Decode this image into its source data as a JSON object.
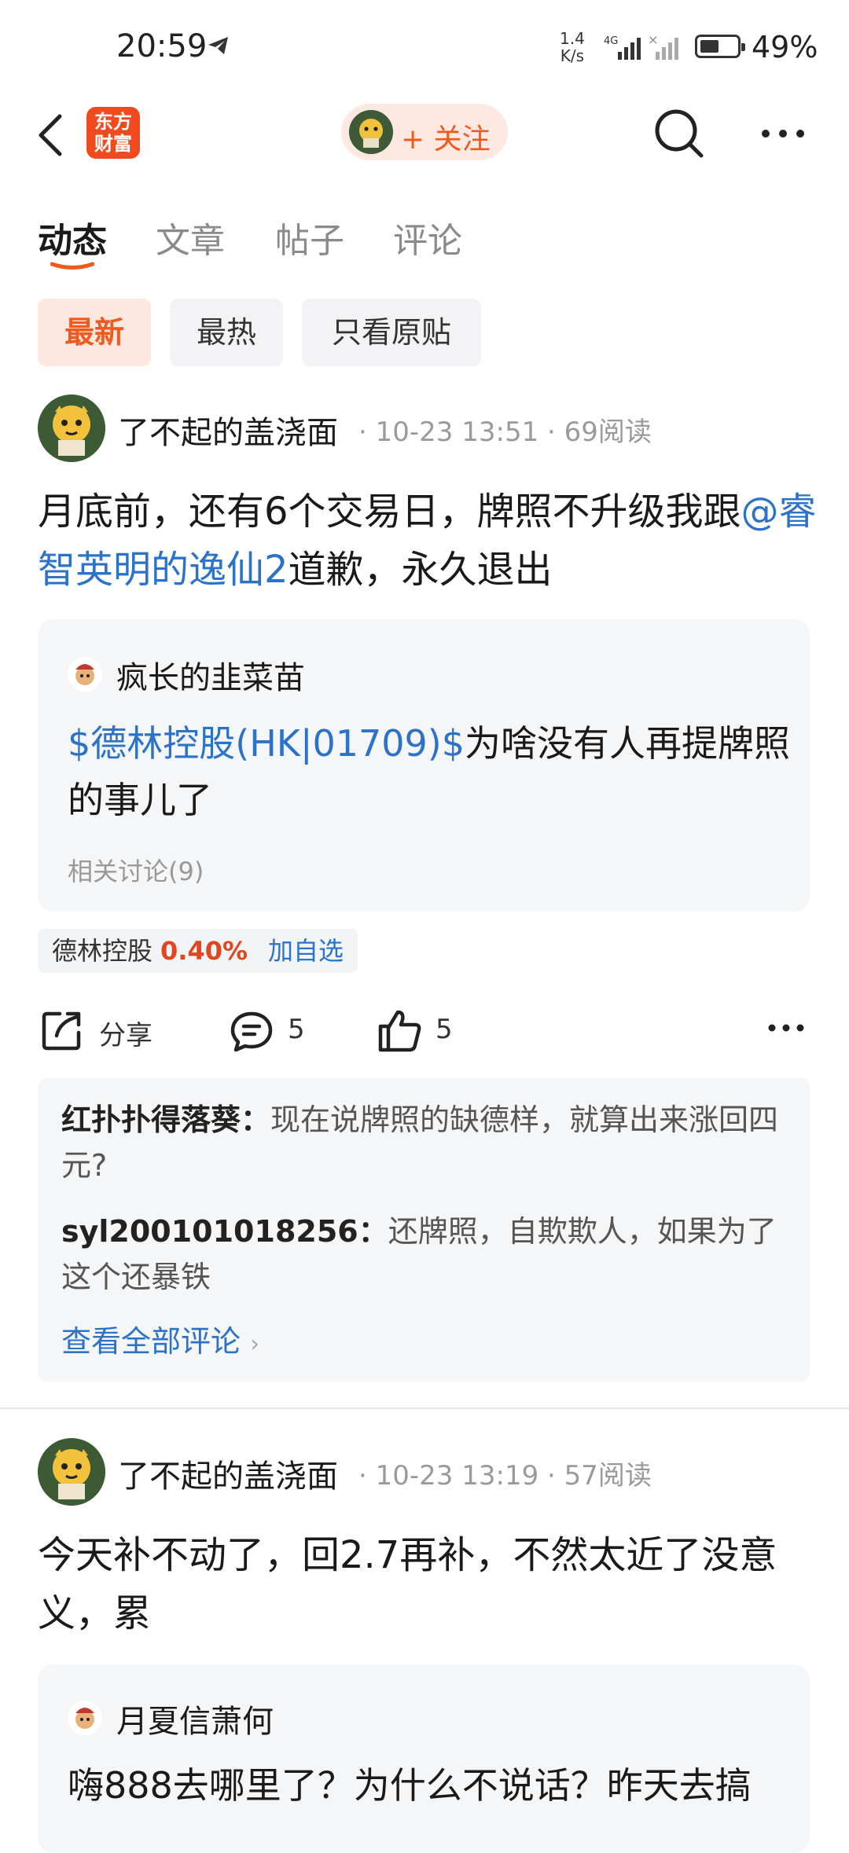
{
  "status_bar": {
    "time": "20:59",
    "net_speed_value": "1.4",
    "net_speed_unit": "K/s",
    "network_type": "4G",
    "battery_percent": "49%",
    "battery_level": 0.49
  },
  "header": {
    "logo_line1": "东方",
    "logo_line2": "财富",
    "follow_label": "+ 关注",
    "accent": "#f05a1e"
  },
  "tabs": [
    "动态",
    "文章",
    "帖子",
    "评论"
  ],
  "filters": [
    "最新",
    "最热",
    "只看原贴"
  ],
  "posts": [
    {
      "author": "了不起的盖浇面",
      "meta": "· 10-23 13:51 · 69阅读",
      "text_before": "月底前，还有6个交易日，牌照不升级我跟",
      "mention": "@睿智英明的逸仙2",
      "text_after": "道歉，永久退出",
      "quote": {
        "author": "疯长的韭菜苗",
        "stock": "$德林控股(HK|01709)$",
        "text": "为啥没有人再提牌照的事儿了",
        "related": "相关讨论(9)"
      },
      "stock_chip": {
        "name": "德林控股",
        "change": "0.40%",
        "add": "加自选"
      },
      "actions": {
        "share": "分享",
        "comments": "5",
        "likes": "5"
      },
      "comment_list": [
        {
          "user": "红扑扑得落葵：",
          "text": "现在说牌照的缺德样，就算出来涨回四元?"
        },
        {
          "user": "syl200101018256：",
          "text": "还牌照，自欺欺人，如果为了这个还暴铁"
        }
      ],
      "view_all": "查看全部评论"
    },
    {
      "author": "了不起的盖浇面",
      "meta": "· 10-23 13:19 · 57阅读",
      "text": "今天补不动了，回2.7再补，不然太近了没意义，累",
      "quote": {
        "author": "月夏信萧何",
        "text": "嗨888去哪里了？为什么不说话？昨天去搞"
      }
    }
  ]
}
